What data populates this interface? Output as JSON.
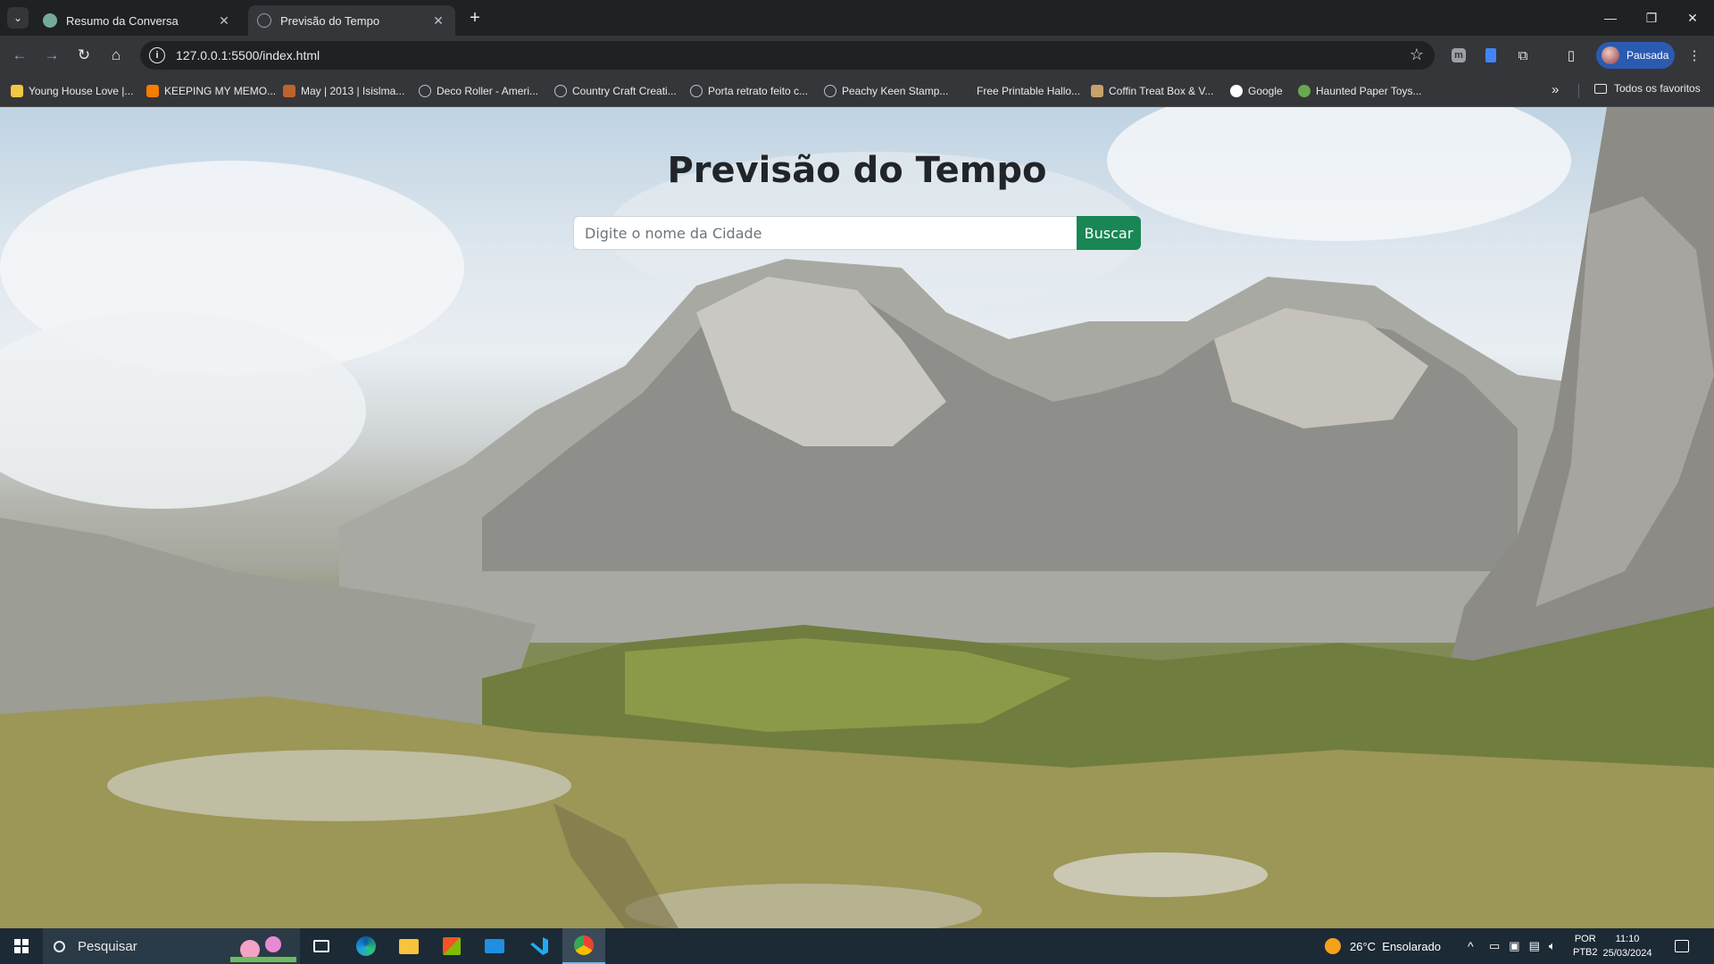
{
  "browser": {
    "tabs": [
      {
        "title": "Resumo da Conversa",
        "active": false
      },
      {
        "title": "Previsão do Tempo",
        "active": true
      }
    ],
    "url": "127.0.0.1:5500/index.html",
    "profile_label": "Pausada",
    "bookmarks": [
      "Young House Love |...",
      "KEEPING MY MEMO...",
      "May | 2013 | Isislma...",
      "Deco Roller - Ameri...",
      "Country Craft Creati...",
      "Porta retrato feito c...",
      "Peachy Keen Stamp...",
      "Free Printable Hallo...",
      "Coffin Treat Box & V...",
      "Google",
      "Haunted Paper Toys..."
    ],
    "all_bookmarks_label": "Todos os favoritos"
  },
  "page": {
    "title": "Previsão do Tempo",
    "search_placeholder": "Digite o nome da Cidade",
    "search_value": "",
    "search_button": "Buscar"
  },
  "taskbar": {
    "search_placeholder": "Pesquisar",
    "weather": "26°C  Ensolarado",
    "language": "POR",
    "layout": "PTB2",
    "time": "11:10",
    "date": "25/03/2024"
  },
  "colors": {
    "search_button": "#198754",
    "tab_active": "#35363a",
    "taskbar": "#1c2a36"
  }
}
